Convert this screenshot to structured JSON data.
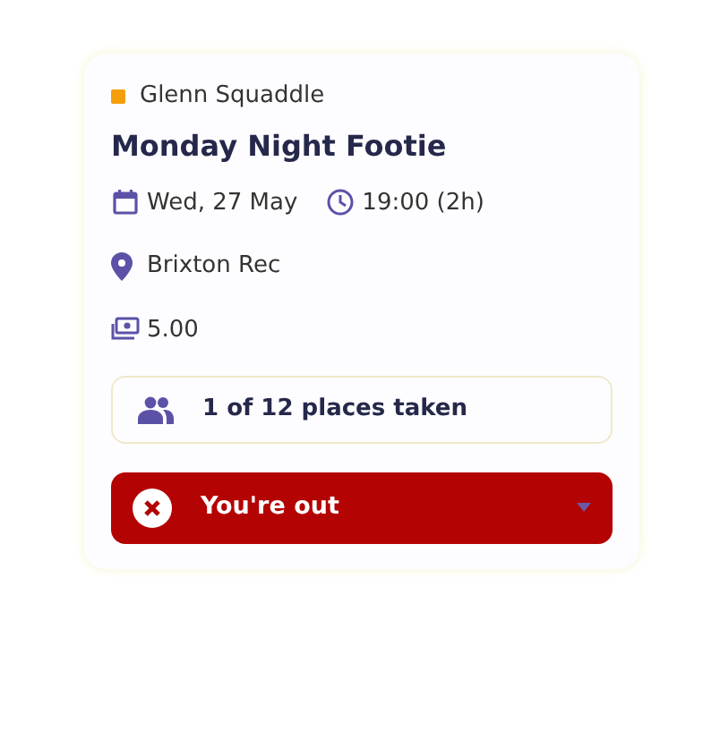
{
  "organiser": {
    "name": "Glenn Squaddle",
    "color": "#f59e0b"
  },
  "title": "Monday Night Footie",
  "date": "Wed, 27 May",
  "time": "19:00 (2h)",
  "location": "Brixton Rec",
  "price": "5.00",
  "places": "1 of 12 places taken",
  "rsvp": {
    "label": "You're out",
    "kind": "out"
  }
}
